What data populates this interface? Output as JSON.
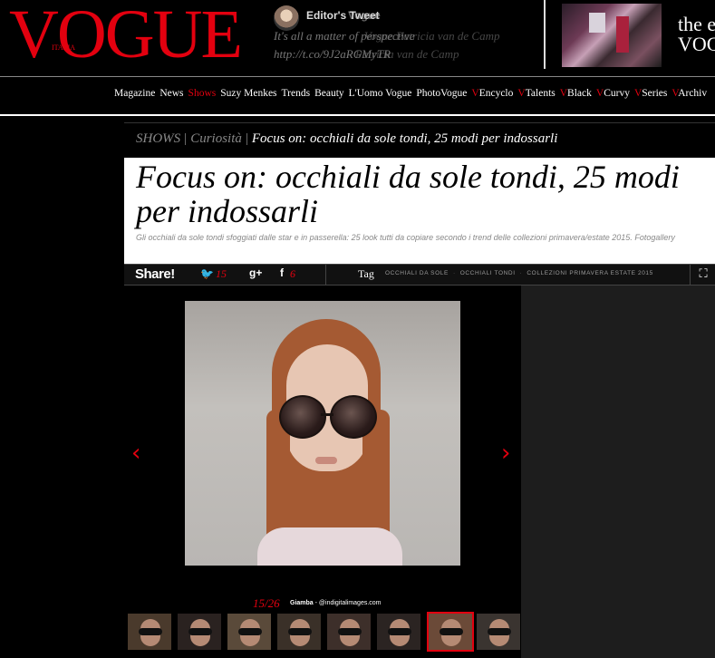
{
  "header": {
    "logo_text": "VOGUE",
    "logo_sub": "ITALIA",
    "tweet_title": "Editor's Tweet",
    "tweet_title_overlap": "Vogue",
    "tweet_line1": "It's all a matter of perspective",
    "tweet_line2": "http://t.co/9J2aRGMyTR",
    "tweet_ghost1": "Vogue Patricia van de Camp",
    "tweet_ghost2": "Patricia van de Camp",
    "promo_line1": "the ev",
    "promo_line2": "VOG"
  },
  "nav": {
    "items": [
      {
        "label": "Magazine",
        "prefix": ""
      },
      {
        "label": "News",
        "prefix": ""
      },
      {
        "label": "Shows",
        "prefix": "",
        "active": true
      },
      {
        "label": "Suzy Menkes",
        "prefix": ""
      },
      {
        "label": "Trends",
        "prefix": ""
      },
      {
        "label": "Beauty",
        "prefix": ""
      },
      {
        "label": "L'Uomo Vogue",
        "prefix": ""
      },
      {
        "label": "PhotoVogue",
        "prefix": ""
      },
      {
        "label": "Encyclo",
        "prefix": "V"
      },
      {
        "label": "Talents",
        "prefix": "V"
      },
      {
        "label": "Black",
        "prefix": "V"
      },
      {
        "label": "Curvy",
        "prefix": "V"
      },
      {
        "label": "Series",
        "prefix": "V"
      },
      {
        "label": "Archiv",
        "prefix": "V"
      }
    ]
  },
  "breadcrumb": {
    "section": "SHOWS",
    "category": "Curiosità",
    "current": "Focus on: occhiali da sole tondi, 25 modi per indossarli"
  },
  "article": {
    "title": "Focus on: occhiali da sole tondi, 25 modi per indossarli",
    "subtitle": "Gli occhiali da sole tondi sfoggiati dalle star e in passerella: 25 look tutti da copiare secondo i trend delle collezioni primavera/estate 2015. Fotogallery"
  },
  "share": {
    "label": "Share!",
    "twitter_count": "15",
    "gplus_label": "g+",
    "facebook_label": "f",
    "facebook_count": "6",
    "tag_label": "Tag",
    "tags": [
      "OCCHIALI DA SOLE",
      "OCCHIALI TONDI",
      "COLLEZIONI PRIMAVERA ESTATE 2015"
    ]
  },
  "gallery": {
    "counter": "15/26",
    "credit_name": "Giamba",
    "credit_source": "@indigitalimages.com",
    "thumbnail_count": 8,
    "active_thumbnail": 6
  },
  "colors": {
    "accent": "#e3000f",
    "background": "#000000",
    "title_bg": "#ffffff"
  }
}
